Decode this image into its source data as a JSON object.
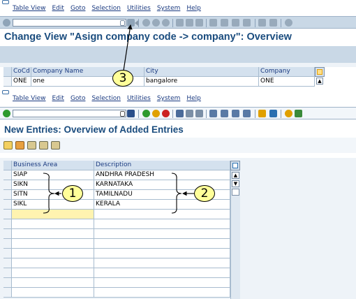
{
  "menu_top": [
    "Table View",
    "Edit",
    "Goto",
    "Selection",
    "Utilities",
    "System",
    "Help"
  ],
  "menu_bottom": [
    "Table View",
    "Edit",
    "Goto",
    "Selection",
    "Utilities",
    "System",
    "Help"
  ],
  "command_field": {
    "value": "",
    "placeholder": ""
  },
  "title_top": "Change View \"Asign company code -> company\": Overview",
  "title_bottom": "New Entries: Overview of Added Entries",
  "company_table": {
    "columns": [
      "CoCd",
      "Company Name",
      "City",
      "Company"
    ],
    "rows": [
      [
        "ONE",
        "one",
        "bangalore",
        "ONE"
      ]
    ]
  },
  "business_area_table": {
    "columns": [
      "Business Area",
      "Description"
    ],
    "rows": [
      [
        "SIAP",
        "ANDHRA PRADESH"
      ],
      [
        "SIKN",
        "KARNATAKA"
      ],
      [
        "SITN",
        "TAMILNADU"
      ],
      [
        "SIKL",
        "KERALA"
      ]
    ]
  },
  "callouts": [
    "1",
    "2",
    "3"
  ],
  "icons": {
    "toolbar_top": [
      "enter-icon",
      "save-icon",
      "back-icon",
      "exit-icon",
      "cancel-icon",
      "print-icon",
      "find-icon",
      "find-next-icon",
      "first-page-icon",
      "previous-page-icon",
      "next-page-icon",
      "last-page-icon",
      "new-session-icon",
      "shortcut-icon",
      "help-icon"
    ],
    "app_toolbar": [
      "change-display-icon",
      "delete-icon",
      "select-all-icon",
      "select-block-icon",
      "deselect-all-icon"
    ]
  },
  "colors": {
    "title": "#1a4c7e",
    "toolbar": "#c9d8e6",
    "header": "#d4e1ee",
    "callout": "#ffff99",
    "selected_cell": "#fff3b0"
  }
}
